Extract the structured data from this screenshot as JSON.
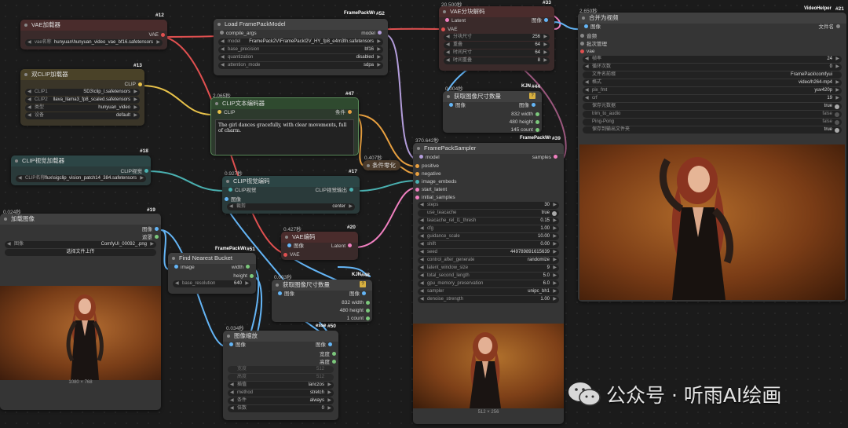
{
  "wm": {
    "text": "公众号 · 听雨AI绘画"
  },
  "vae_loader": {
    "id": "#12",
    "title": "VAE加载器",
    "out": "VAE",
    "label": "vae名称",
    "value": "hunyuan\\hunyuan_video_vae_bf16.safetensors"
  },
  "dual_clip": {
    "id": "#13",
    "title": "双CLIP加载器",
    "out": "CLIP",
    "rows": [
      {
        "label": "CLIP1",
        "value": "SD3\\clip_l.safetensors"
      },
      {
        "label": "CLIP2",
        "value": "llava_llama3_fp8_scaled.safetensors"
      },
      {
        "label": "类型",
        "value": "hunyuan_video"
      },
      {
        "label": "设备",
        "value": "default"
      }
    ]
  },
  "load_fp": {
    "id": "#52",
    "badge": "FramePackWr",
    "title": "Load FramePackModel",
    "in": "compile_args",
    "out": "model",
    "rows": [
      {
        "label": "model",
        "value": "FramePack2V\\FramePackI2V_HY_fp8_e4m3fn.safetensors"
      },
      {
        "label": "base_precision",
        "value": "bf16"
      },
      {
        "label": "quantization",
        "value": "disabled"
      },
      {
        "label": "attention_mode",
        "value": "sdpa"
      }
    ]
  },
  "vae_dec": {
    "id": "#33",
    "time": "20.500秒",
    "title": "VAE分块解码",
    "in1": "Latent",
    "in2": "VAE",
    "out": "图像",
    "rows": [
      {
        "label": "分块尺寸",
        "value": "256"
      },
      {
        "label": "重叠",
        "value": "64"
      },
      {
        "label": "时间尺寸",
        "value": "64"
      },
      {
        "label": "时间重叠",
        "value": "8"
      }
    ]
  },
  "clip_text": {
    "id": "#47",
    "time": "2.065秒",
    "title": "CLIP文本编码器",
    "in": "CLIP",
    "out": "条件",
    "text": "The girl dances gracefully, with clear movements, full of charm."
  },
  "clip_vision_loader": {
    "id": "#18",
    "title": "CLIP视觉加载器",
    "out": "CLIP视觉",
    "label": "CLIP名称",
    "value": "flux\\sigclip_vision_patch14_384.safetensors"
  },
  "cond_zero": {
    "time": "0.407秒",
    "title": "条件零化"
  },
  "clip_vis_enc": {
    "id": "#17",
    "time": "0.927秒",
    "title": "CLIP视觉编码",
    "in1": "CLIP视觉",
    "in2": "图像",
    "out": "CLIP视觉输出",
    "label": "裁剪",
    "value": "center"
  },
  "get_size1": {
    "id": "#44",
    "badge": "KJN",
    "time": "0.004秒",
    "title": "获取图像尺寸数量",
    "in": "图像",
    "outs": [
      "图像",
      "832 width",
      "480 height",
      "145 count"
    ]
  },
  "load_img": {
    "id": "#19",
    "time": "0.024秒",
    "title": "加载图像",
    "outs": [
      "图像",
      "遮罩"
    ],
    "label": "图像",
    "value": "ComfyUI_00092_.png",
    "btn": "选择文件上传",
    "caption": "1080 × 768"
  },
  "nearest": {
    "id": "#51",
    "badge": "FramePackWr",
    "title": "Find Nearest Bucket",
    "in": "image",
    "outs": [
      "width",
      "height"
    ],
    "label": "base_resolution",
    "value": "640"
  },
  "vae_enc": {
    "id": "#20",
    "time": "0.427秒",
    "title": "VAE编码",
    "ins": [
      "图像",
      "VAE"
    ],
    "out": "Latent"
  },
  "get_size2": {
    "id": "#48",
    "badge": "KJN",
    "time": "0.003秒",
    "title": "获取图像尺寸数量",
    "in": "图像",
    "outs": [
      "图像",
      "832 width",
      "480 height",
      "1 count"
    ]
  },
  "img_scale": {
    "id": "#50",
    "badge": "esse",
    "time": "0.034秒",
    "title": "图像缩放",
    "in": "图像",
    "outs": [
      "图像",
      "宽度",
      "高度"
    ],
    "rows": [
      {
        "label": "宽度",
        "value": "512",
        "dis": true
      },
      {
        "label": "高度",
        "value": "512",
        "dis": true
      },
      {
        "label": "插值",
        "value": "lanczos"
      },
      {
        "label": "method",
        "value": "stretch"
      },
      {
        "label": "条件",
        "value": "always"
      },
      {
        "label": "倍数",
        "value": "0"
      }
    ]
  },
  "sampler": {
    "id": "#39",
    "badge": "FramePackWr",
    "time": "370.642秒",
    "title": "FramePackSampler",
    "ins": [
      "model",
      "positive",
      "negative",
      "image_embeds",
      "start_latent",
      "initial_samples"
    ],
    "out": "samples",
    "rows": [
      {
        "label": "steps",
        "value": "30"
      },
      {
        "label": "use_teacache",
        "value": "true",
        "toggle": true
      },
      {
        "label": "teacache_rel_l1_thresh",
        "value": "0.15"
      },
      {
        "label": "cfg",
        "value": "1.00"
      },
      {
        "label": "guidance_scale",
        "value": "10.00"
      },
      {
        "label": "shift",
        "value": "0.00"
      },
      {
        "label": "seed",
        "value": "449789891615639"
      },
      {
        "label": "control_after_generate",
        "value": "randomize"
      },
      {
        "label": "latent_window_size",
        "value": "9"
      },
      {
        "label": "total_second_length",
        "value": "5.0"
      },
      {
        "label": "gpu_memory_preservation",
        "value": "6.0"
      },
      {
        "label": "sampler",
        "value": "unipc_bh1"
      },
      {
        "label": "denoise_strength",
        "value": "1.00"
      }
    ],
    "caption": "512 × 256"
  },
  "combine": {
    "id": "#21",
    "badge": "VideoHelper",
    "time": "2.650秒",
    "title": "合并为视频",
    "ins": [
      "图像",
      "音频",
      "批次管理",
      "vae"
    ],
    "out": "文件名",
    "rows": [
      {
        "label": "帧率",
        "value": "24"
      },
      {
        "label": "循环次数",
        "value": "0"
      },
      {
        "label": "文件名前缀",
        "value": "FramePack\\comfyui"
      },
      {
        "label": "格式",
        "value": "video/h264-mp4"
      },
      {
        "label": "pix_fmt",
        "value": "yuv420p"
      },
      {
        "label": "crf",
        "value": "19"
      },
      {
        "label": "保存元数据",
        "value": "true",
        "toggle": true
      },
      {
        "label": "trim_to_audio",
        "value": "false",
        "toggle": true,
        "off": true
      },
      {
        "label": "Ping-Pong",
        "value": "false",
        "toggle": true,
        "off": true
      },
      {
        "label": "保存到输出文件夹",
        "value": "true",
        "toggle": true
      }
    ]
  }
}
